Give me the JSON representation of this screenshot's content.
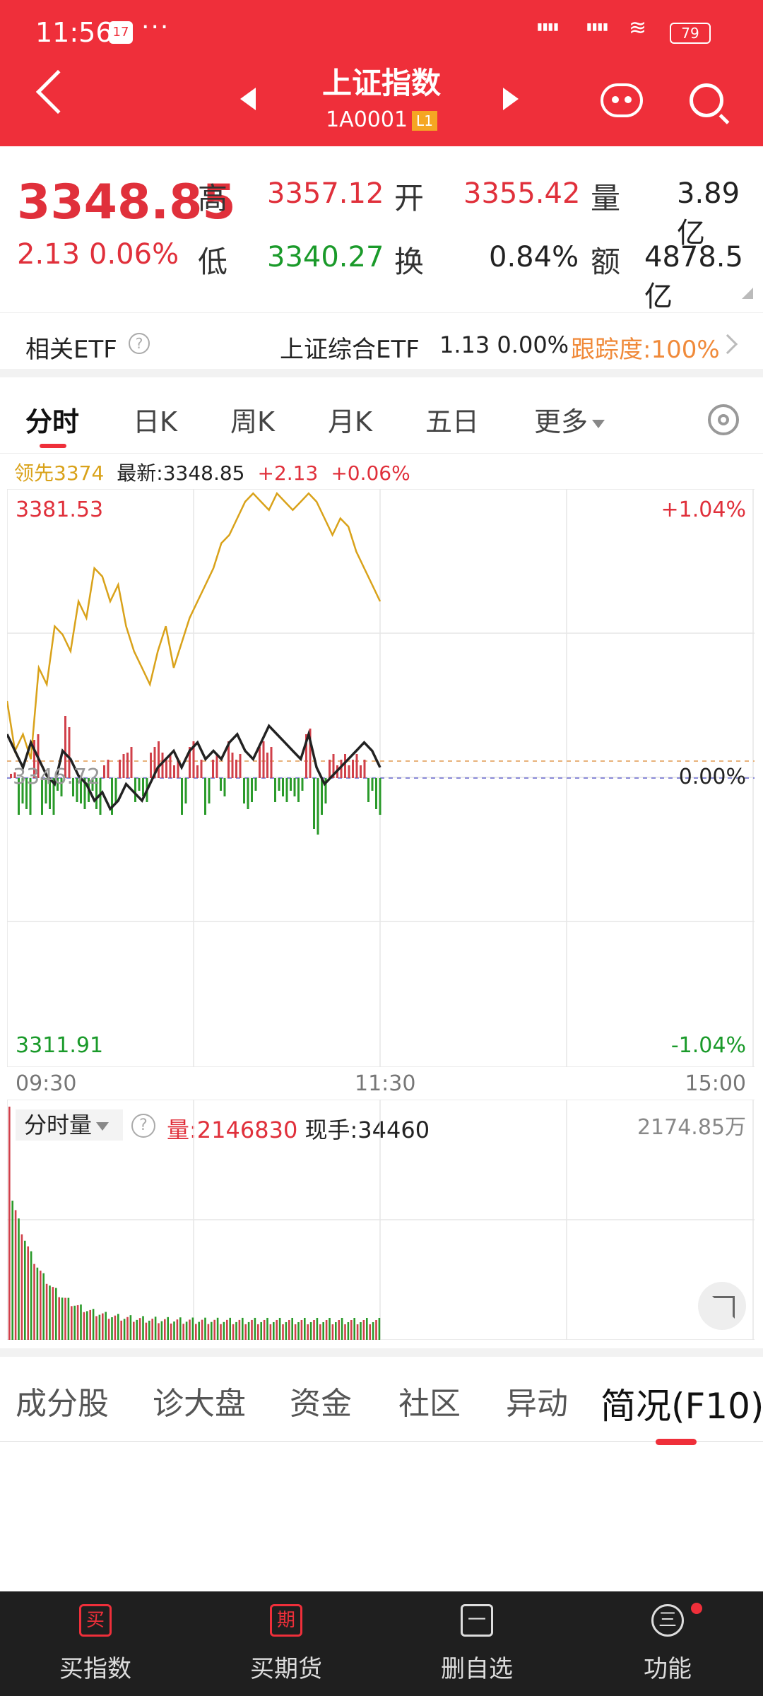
{
  "status_bar": {
    "time": "11:56",
    "notif_badge": "17",
    "more": "···",
    "battery": "79"
  },
  "header": {
    "title": "上证指数",
    "code": "1A0001",
    "level_badge": "L1"
  },
  "quote": {
    "price": "3348.85",
    "change": "2.13",
    "change_pct": "0.06%",
    "high_label": "高",
    "high": "3357.12",
    "low_label": "低",
    "low": "3340.27",
    "open_label": "开",
    "open": "3355.42",
    "turnover_label": "换",
    "turnover": "0.84%",
    "volume_label": "量",
    "volume": "3.89亿",
    "amount_label": "额",
    "amount": "4878.5亿"
  },
  "etf": {
    "label": "相关ETF",
    "name": "上证综合ETF",
    "price": "1.13",
    "pct": "0.00%",
    "tracking": "跟踪度:100%"
  },
  "tabs": [
    {
      "label": "分时"
    },
    {
      "label": "日K"
    },
    {
      "label": "周K"
    },
    {
      "label": "月K"
    },
    {
      "label": "五日"
    },
    {
      "label": "更多"
    }
  ],
  "chart_info": {
    "lead": "领先3374",
    "latest": "最新:3348.85",
    "chg": "+2.13",
    "pct": "+0.06%"
  },
  "axis": {
    "y_top": "3381.53",
    "y_bottom": "3311.91",
    "pct_top": "+1.04%",
    "pct_mid": "0.00%",
    "pct_bottom": "-1.04%",
    "y_mid": "3346.72",
    "t_start": "09:30",
    "t_mid": "11:30",
    "t_end": "15:00"
  },
  "volume_panel": {
    "button": "分时量",
    "vol": "量:2146830",
    "hand": "现手:34460",
    "max": "2174.85万"
  },
  "bottom_tabs": [
    {
      "label": "成分股"
    },
    {
      "label": "诊大盘"
    },
    {
      "label": "资金"
    },
    {
      "label": "社区"
    },
    {
      "label": "异动"
    },
    {
      "label": "简况(F10)"
    }
  ],
  "bottom_bar": [
    {
      "icon": "买",
      "label": "买指数"
    },
    {
      "icon": "期",
      "label": "买期货"
    },
    {
      "icon": "一",
      "label": "删自选"
    },
    {
      "icon": "三",
      "label": "功能"
    }
  ],
  "colors": {
    "brand": "#ef2f3a",
    "up": "#e0303b",
    "down": "#1a9a2a",
    "lead_line": "#d9a21a",
    "price_line": "#222222"
  },
  "chart_data": {
    "type": "line",
    "x_range": [
      "09:30",
      "15:00"
    ],
    "ylim": [
      3311.91,
      3381.53
    ],
    "prev_close": 3346.72,
    "series": [
      {
        "name": "领先",
        "values": [
          3356,
          3350,
          3352,
          3349,
          3360,
          3358,
          3365,
          3364,
          3362,
          3368,
          3366,
          3372,
          3371,
          3368,
          3370,
          3365,
          3362,
          3360,
          3358,
          3362,
          3365,
          3360,
          3363,
          3366,
          3368,
          3370,
          3372,
          3375,
          3376,
          3378,
          3380,
          3381,
          3380,
          3379,
          3381,
          3380,
          3379,
          3380,
          3381,
          3380,
          3378,
          3376,
          3378,
          3377,
          3374,
          3372,
          3370,
          3368
        ]
      },
      {
        "name": "最新",
        "values": [
          3352,
          3350,
          3348,
          3351,
          3349,
          3347,
          3346,
          3350,
          3349,
          3347,
          3346,
          3344,
          3345,
          3343,
          3344,
          3346,
          3345,
          3344,
          3346,
          3348,
          3349,
          3350,
          3348,
          3350,
          3351,
          3349,
          3350,
          3349,
          3351,
          3352,
          3350,
          3349,
          3351,
          3353,
          3352,
          3351,
          3350,
          3349,
          3352,
          3348,
          3346,
          3347,
          3348,
          3349,
          3350,
          3351,
          3350,
          3348
        ]
      }
    ]
  }
}
